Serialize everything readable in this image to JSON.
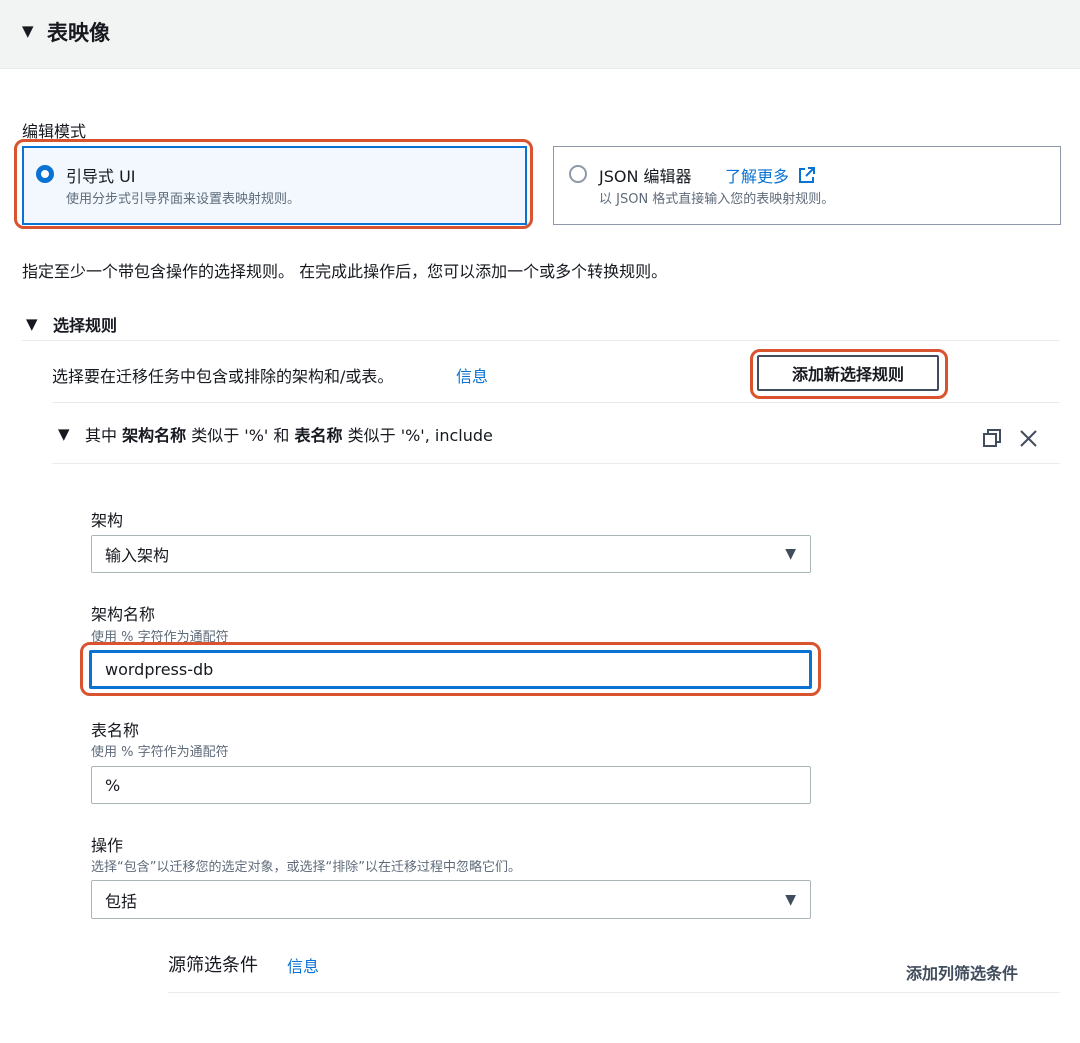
{
  "header": {
    "title": "表映像"
  },
  "edit_mode": {
    "label": "编辑模式",
    "guided": {
      "title": "引导式 UI",
      "description": "使用分步式引导界面来设置表映射规则。",
      "selected": true
    },
    "json": {
      "title": "JSON 编辑器",
      "learn_more": "了解更多",
      "description": "以 JSON 格式直接输入您的表映射规则。",
      "selected": false
    }
  },
  "instruction": "指定至少一个带包含操作的选择规则。 在完成此操作后，您可以添加一个或多个转换规则。",
  "selection_rules": {
    "title": "选择规则",
    "description": "选择要在迁移任务中包含或排除的架构和/或表。",
    "info": "信息",
    "add_button": "添加新选择规则"
  },
  "rule": {
    "summary": {
      "prefix": "其中",
      "schema_label": "架构名称",
      "like1": "类似于 '%' 和",
      "table_label": "表名称",
      "like2": "类似于 '%', include"
    },
    "schema": {
      "label": "架构",
      "value": "输入架构"
    },
    "schema_name": {
      "label": "架构名称",
      "hint": "使用 % 字符作为通配符",
      "value": "wordpress-db"
    },
    "table_name": {
      "label": "表名称",
      "hint": "使用 % 字符作为通配符",
      "value": "%"
    },
    "action": {
      "label": "操作",
      "hint": "选择“包含”以迁移您的选定对象，或选择“排除”以在迁移过程中忽略它们。",
      "value": "包括"
    },
    "source_filter": {
      "title": "源筛选条件",
      "info": "信息",
      "add_column_filter": "添加列筛选条件"
    }
  },
  "colors": {
    "accent": "#0972d3",
    "highlight": "#d9532e"
  }
}
